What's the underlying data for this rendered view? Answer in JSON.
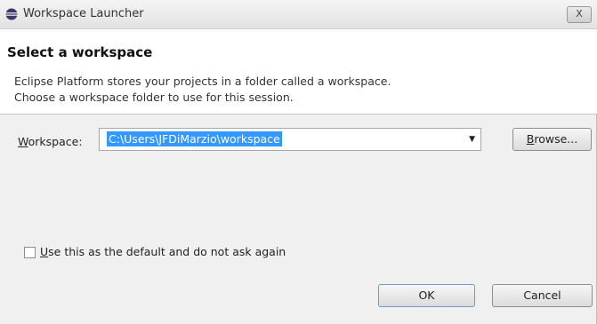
{
  "window": {
    "title": "Workspace Launcher",
    "close_label": "X"
  },
  "header": {
    "title": "Select a workspace",
    "description_line1": "Eclipse Platform stores your projects in a folder called a workspace.",
    "description_line2": "Choose a workspace folder to use for this session."
  },
  "workspace": {
    "label_mnemonic": "W",
    "label_rest": "orkspace:",
    "value": "C:\\Users\\JFDiMarzio\\workspace",
    "browse_mnemonic": "B",
    "browse_rest": "rowse..."
  },
  "default_checkbox": {
    "checked": false,
    "label_mnemonic": "U",
    "label_rest": "se this as the default and do not ask again"
  },
  "buttons": {
    "ok": "OK",
    "cancel": "Cancel"
  },
  "icons": {
    "app": "eclipse-icon",
    "dropdown": "chevron-down-icon",
    "close": "close-icon"
  }
}
